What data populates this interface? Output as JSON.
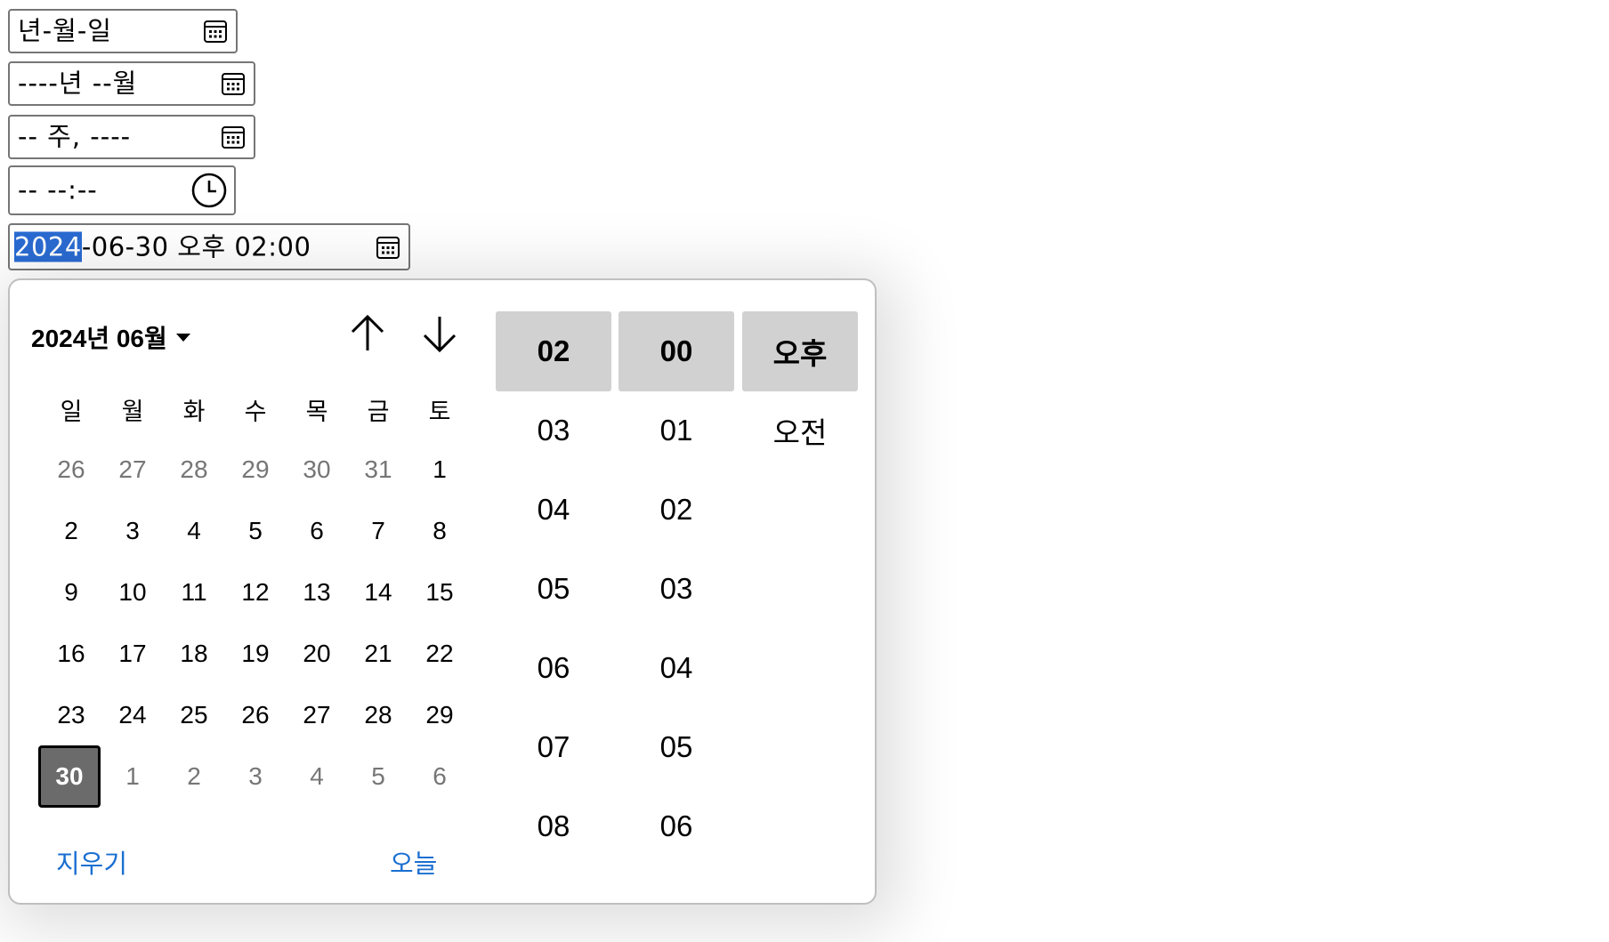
{
  "inputs": {
    "date": {
      "text": "년-월-일",
      "icon": "calendar-icon"
    },
    "month": {
      "text": "----년 --월",
      "icon": "calendar-icon"
    },
    "week": {
      "text": "-- 주, ----",
      "icon": "calendar-icon"
    },
    "time": {
      "text": "-- --:--",
      "icon": "clock-icon"
    },
    "datetime": {
      "selected_part": "2024",
      "rest": "-06-30 오후 02:00",
      "icon": "calendar-icon"
    }
  },
  "picker": {
    "month_label": "2024년 06월",
    "weekdays": [
      "일",
      "월",
      "화",
      "수",
      "목",
      "금",
      "토"
    ],
    "weeks": [
      [
        "26",
        "27",
        "28",
        "29",
        "30",
        "31",
        "1"
      ],
      [
        "2",
        "3",
        "4",
        "5",
        "6",
        "7",
        "8"
      ],
      [
        "9",
        "10",
        "11",
        "12",
        "13",
        "14",
        "15"
      ],
      [
        "16",
        "17",
        "18",
        "19",
        "20",
        "21",
        "22"
      ],
      [
        "23",
        "24",
        "25",
        "26",
        "27",
        "28",
        "29"
      ],
      [
        "30",
        "1",
        "2",
        "3",
        "4",
        "5",
        "6"
      ]
    ],
    "selected_day": "30",
    "clear_label": "지우기",
    "today_label": "오늘",
    "hours": [
      "02",
      "03",
      "04",
      "05",
      "06",
      "07",
      "08"
    ],
    "minutes": [
      "00",
      "01",
      "02",
      "03",
      "04",
      "05",
      "06"
    ],
    "ampm": [
      "오후",
      "오전"
    ]
  },
  "colors": {
    "accent": "#2a6bd2",
    "link": "#1a6fd1",
    "selected_cell": "#d1d1d1",
    "selected_day": "#6b6b6b"
  }
}
